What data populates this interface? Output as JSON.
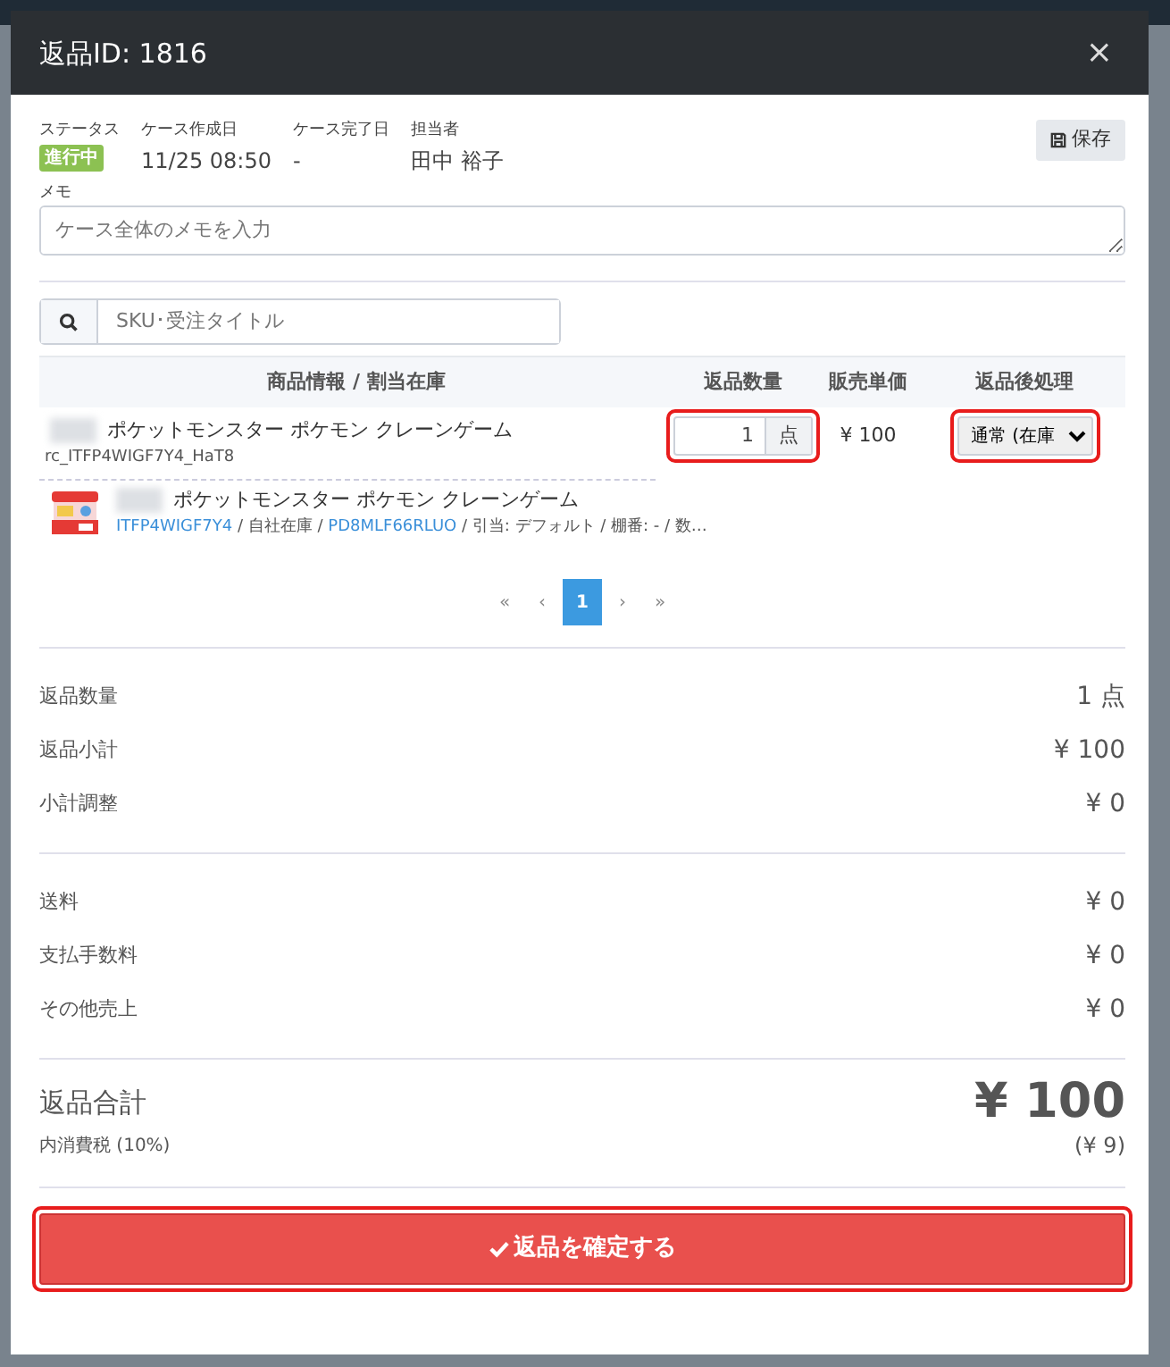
{
  "modal": {
    "title": "返品ID: 1816",
    "close": "×"
  },
  "case_info": [
    {
      "label": "ステータス",
      "value": "進行中",
      "kind": "badge"
    },
    {
      "label": "ケース作成日",
      "value": "11/25 08:50",
      "kind": "text"
    },
    {
      "label": "ケース完了日",
      "value": "-",
      "kind": "text"
    },
    {
      "label": "担当者",
      "value": "田中 裕子",
      "kind": "text"
    }
  ],
  "save_button": "保存",
  "memo": {
    "label": "メモ",
    "placeholder": "ケース全体のメモを入力"
  },
  "search": {
    "placeholder": "SKU･受注タイトル"
  },
  "table": {
    "columns": [
      "商品情報 / 割当在庫",
      "返品数量",
      "販売単価",
      "返品後処理"
    ],
    "rows": [
      {
        "title": "ポケットモンスター ポケモン クレーンゲーム",
        "sku": "rc_ITFP4WIGF7Y4_HaT8",
        "stock": {
          "title": "ポケットモンスター ポケモン クレーンゲーム",
          "code": "ITFP4WIGF7Y4",
          "sep1": " / 自社在庫 / ",
          "location": "PD8MLF66RLUO",
          "rest": " / 引当: デフォルト / 棚番: - / 数…"
        },
        "quantity": "1",
        "unit": "点",
        "quantity_highlighted": true,
        "price": "¥ 100",
        "handling": "通常 (在庫",
        "handling_highlighted": true
      }
    ]
  },
  "pagination": [
    {
      "label": "«",
      "selected": false
    },
    {
      "label": "‹",
      "selected": false
    },
    {
      "label": "1",
      "selected": true
    },
    {
      "label": "›",
      "selected": false
    },
    {
      "label": "»",
      "selected": false
    }
  ],
  "summary_groups": [
    [
      {
        "label": "返品数量",
        "value": "1 点"
      },
      {
        "label": "返品小計",
        "value": "¥ 100"
      },
      {
        "label": "小計調整",
        "value": "¥ 0"
      }
    ],
    [
      {
        "label": "送料",
        "value": "¥ 0"
      },
      {
        "label": "支払手数料",
        "value": "¥ 0"
      },
      {
        "label": "その他売上",
        "value": "¥ 0"
      }
    ]
  ],
  "total": {
    "label": "返品合計",
    "value": "¥ 100",
    "tax_label": "内消費税 (10%)",
    "tax_value": "(¥ 9)"
  },
  "confirm_button": {
    "label": "返品を確定する",
    "highlighted": true
  }
}
